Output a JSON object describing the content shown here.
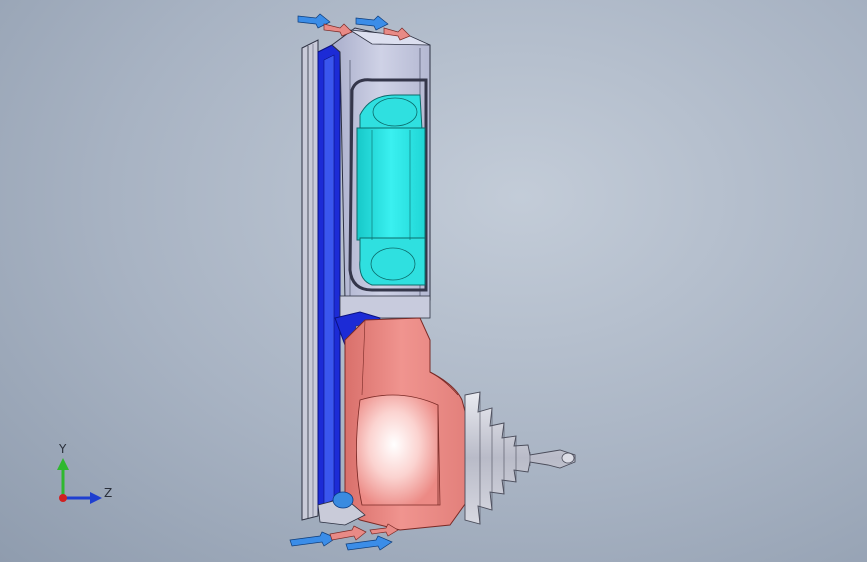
{
  "viewport": {
    "background_top": "#c3ccd8",
    "background_bottom": "#8f9cae"
  },
  "triad": {
    "y_label": "Y",
    "z_label": "Z",
    "y_color": "#2fb82f",
    "z_color": "#1f3fd0",
    "x_color": "#d02020"
  },
  "model": {
    "name": "cad-assembly-section-view",
    "colors": {
      "frame": "#b8bdd6",
      "frame_edge": "#3a3f55",
      "blue_seal": "#1c2bd6",
      "cyan_part": "#27e6e6",
      "pink_body": "#ec8a85",
      "pink_highlight": "#fbe4e2",
      "silver_bellows": "#c7c9d4",
      "arrow_blue": "#3b8de8",
      "arrow_red": "#e88a86"
    }
  }
}
